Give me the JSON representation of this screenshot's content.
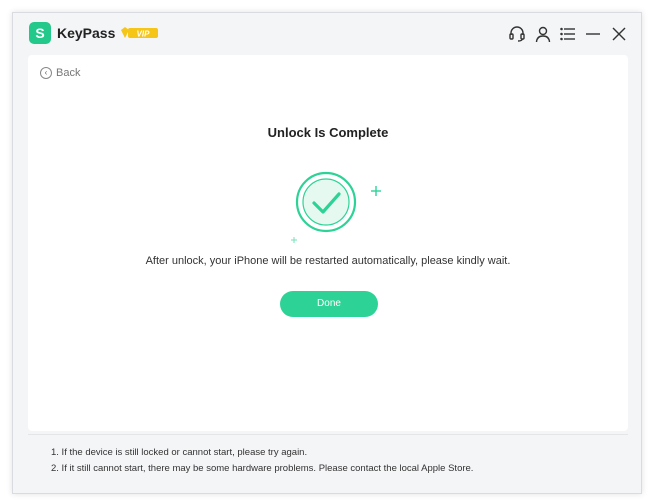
{
  "app": {
    "name": "KeyPass",
    "logo_glyph": "S",
    "vip_label": "VIP"
  },
  "titlebar": {
    "icons": [
      "headset-icon",
      "user-icon",
      "menu-icon",
      "minimize-icon",
      "close-icon"
    ]
  },
  "main": {
    "back_label": "Back",
    "title": "Unlock Is Complete",
    "message": "After unlock, your iPhone will be restarted automatically, please kindly wait.",
    "done_label": "Done"
  },
  "notes": [
    "1. If the device is still locked or cannot start, please try again.",
    "2. If it still cannot start, there may be some hardware problems. Please contact the local Apple Store."
  ],
  "colors": {
    "accent": "#2dd396",
    "logo": "#22c98b",
    "vip": "#f5c518"
  }
}
